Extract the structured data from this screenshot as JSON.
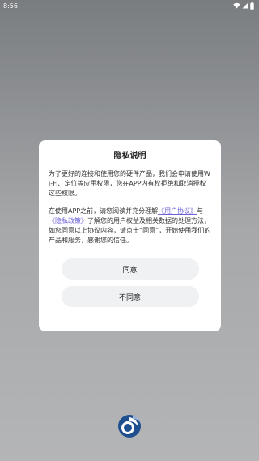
{
  "status_bar": {
    "time": "8:56",
    "icons": [
      "wifi-icon",
      "signal-icon",
      "battery-icon"
    ]
  },
  "dialog": {
    "title": "隐私说明",
    "paragraph1": "为了更好的连接和使用您的硬件产品，我们会申请使用Wi-Fi、定位等应用权限，您在APP内有权拒绝和取消授权这些权限。",
    "paragraph2_prefix": "在使用APP之前，请您阅读并充分理解",
    "user_agreement_link": "《用户协议》",
    "paragraph2_mid": "与",
    "privacy_policy_link": "《隐私政策》",
    "paragraph2_suffix": "了解您的用户权益及相关数据的处理方法，如您同意以上协议内容，请点击“同意”，开始使用我们的产品和服务，感谢您的信任。",
    "agree_label": "同意",
    "disagree_label": "不同意"
  },
  "colors": {
    "link": "#6b62d8",
    "logo_blue": "#1f4f8f"
  },
  "logo": {
    "icon": "app-logo-icon"
  }
}
